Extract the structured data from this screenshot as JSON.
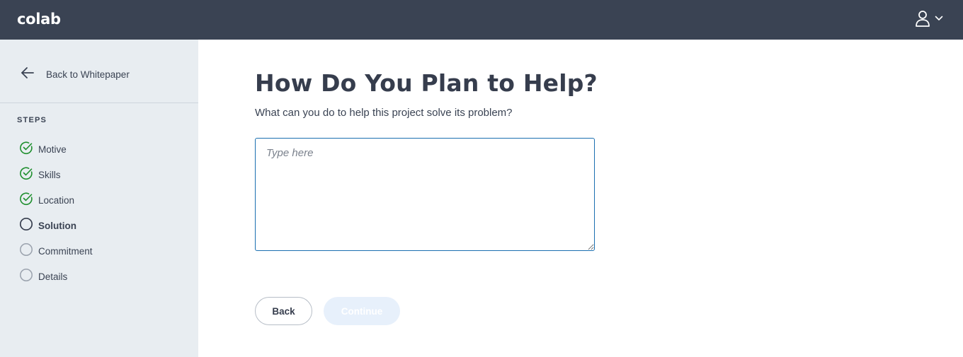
{
  "header": {
    "logo_text": "colab",
    "account_icon": "user-icon",
    "account_menu_icon": "chevron-down-icon"
  },
  "sidebar": {
    "back_label": "Back to Whitepaper",
    "back_icon": "arrow-left-icon",
    "steps_heading": "STEPS",
    "steps": [
      {
        "label": "Motive",
        "status": "complete",
        "icon": "check-circle-icon"
      },
      {
        "label": "Skills",
        "status": "complete",
        "icon": "check-circle-icon"
      },
      {
        "label": "Location",
        "status": "complete",
        "icon": "check-circle-icon"
      },
      {
        "label": "Solution",
        "status": "current",
        "icon": "circle-icon"
      },
      {
        "label": "Commitment",
        "status": "pending",
        "icon": "circle-icon"
      },
      {
        "label": "Details",
        "status": "pending",
        "icon": "circle-icon"
      }
    ]
  },
  "main": {
    "title": "How Do You Plan to Help?",
    "subtitle": "What can you do to help this project solve its problem?",
    "answer_placeholder": "Type here",
    "answer_value": "",
    "back_button": "Back",
    "continue_button": "Continue",
    "continue_enabled": false
  },
  "colors": {
    "header_bg": "#3a4353",
    "sidebar_bg": "#e8edf1",
    "step_complete": "#1f8f2e",
    "step_current": "#363d4d",
    "step_pending": "#9aa2ad",
    "input_border_focus": "#1a6fb0",
    "continue_disabled_bg": "#e7f0fb"
  }
}
